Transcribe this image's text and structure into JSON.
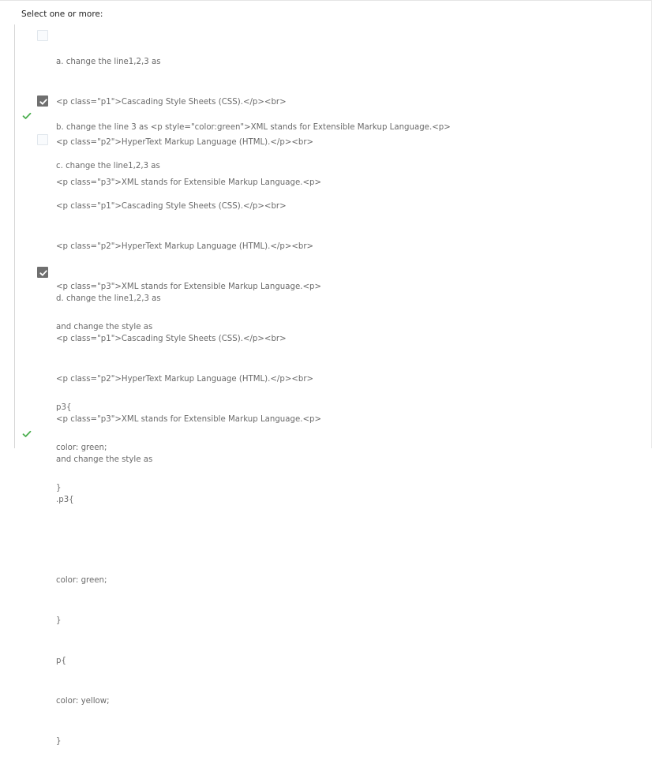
{
  "prompt": "Select one or more:",
  "options": [
    {
      "checked": false,
      "lines": [
        "a. change the line1,2,3 as",
        "<p class=\"p1\">Cascading Style Sheets (CSS).</p><br>",
        "<p class=\"p2\">HyperText Markup Language (HTML).</p><br>",
        "<p class=\"p3\">XML stands for Extensible Markup Language.<p>"
      ]
    },
    {
      "checked": true,
      "lines": [
        "b. change the line 3 as <p style=\"color:green\">XML stands for Extensible Markup Language.<p>"
      ]
    },
    {
      "checked": false,
      "lines": [
        "c. change the line1,2,3 as",
        "<p class=\"p1\">Cascading Style Sheets (CSS).</p><br>",
        "<p class=\"p2\">HyperText Markup Language (HTML).</p><br>",
        "<p class=\"p3\">XML stands for Extensible Markup Language.<p>",
        "and change the style as",
        "",
        "p3{",
        "color: green;",
        "}"
      ]
    },
    {
      "checked": true,
      "lines": [
        "d. change the line1,2,3 as",
        "<p class=\"p1\">Cascading Style Sheets (CSS).</p><br>",
        "<p class=\"p2\">HyperText Markup Language (HTML).</p><br>",
        "<p class=\"p3\">XML stands for Extensible Markup Language.<p>",
        "and change the style as",
        ".p3{",
        "",
        "color: green;",
        "}",
        "p{",
        "color: yellow;",
        "}"
      ]
    }
  ],
  "colors": {
    "correct_tick": "#4caf50",
    "checked_box": "#6f6f6f"
  },
  "icons": {
    "checkbox_mark": "check-icon",
    "correct_mark": "correct-check-icon"
  }
}
